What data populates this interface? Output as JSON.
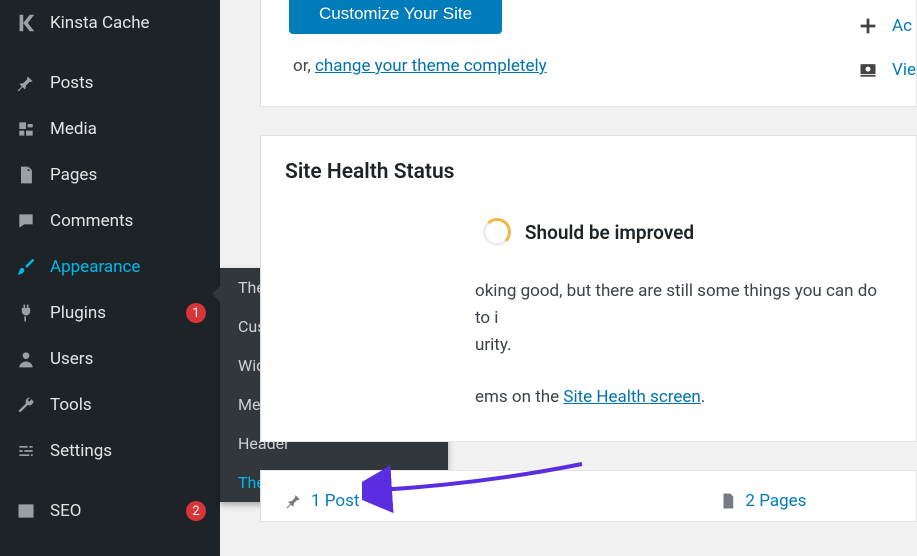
{
  "sidebar": {
    "items": [
      {
        "label": "Kinsta Cache",
        "icon": "kinsta-k-icon"
      },
      {
        "label": "Posts",
        "icon": "pin-icon"
      },
      {
        "label": "Media",
        "icon": "media-icon"
      },
      {
        "label": "Pages",
        "icon": "pages-icon"
      },
      {
        "label": "Comments",
        "icon": "comments-icon"
      },
      {
        "label": "Appearance",
        "icon": "brush-icon",
        "active": true
      },
      {
        "label": "Plugins",
        "icon": "plug-icon",
        "badge": "1"
      },
      {
        "label": "Users",
        "icon": "user-icon"
      },
      {
        "label": "Tools",
        "icon": "wrench-icon"
      },
      {
        "label": "Settings",
        "icon": "sliders-icon"
      },
      {
        "label": "SEO",
        "icon": "yoast-icon",
        "badge": "2"
      }
    ]
  },
  "flyout": {
    "items": [
      {
        "label": "Themes"
      },
      {
        "label": "Customize"
      },
      {
        "label": "Widgets"
      },
      {
        "label": "Menus"
      },
      {
        "label": "Header"
      },
      {
        "label": "Theme Editor",
        "highlight": true
      }
    ]
  },
  "top_panel": {
    "button": "Customize Your Site",
    "or_prefix": "or, ",
    "or_link": "change your theme completely"
  },
  "right_actions": [
    {
      "icon": "plus-icon",
      "label": "Ac"
    },
    {
      "icon": "eye-icon",
      "label": "Vie"
    }
  ],
  "site_health": {
    "title": "Site Health Status",
    "status": "Should be improved",
    "body_line1": "oking good, but there are still some things you can do to i",
    "body_line2": "urity.",
    "body_line3_prefix": "ems on the ",
    "body_line3_link": "Site Health screen",
    "body_line3_suffix": "."
  },
  "glance": {
    "posts_label": "1 Post",
    "pages_label": "2 Pages"
  }
}
